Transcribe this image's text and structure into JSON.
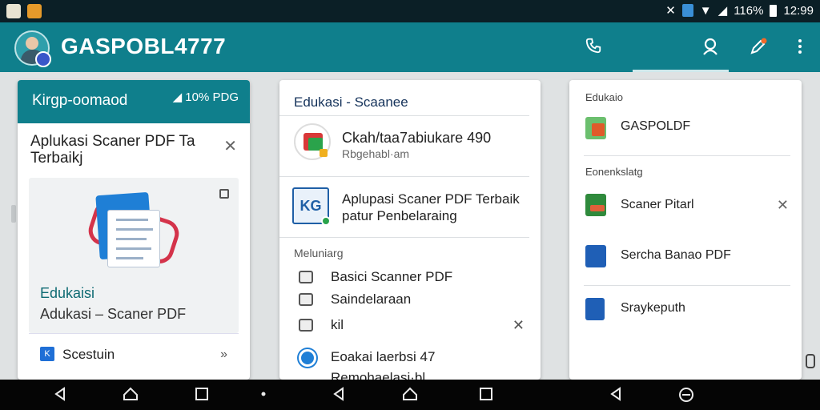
{
  "status_bar": {
    "battery_percent": "116%",
    "time": "12:99",
    "icons": [
      "bluetooth-icon",
      "nfc-icon",
      "wifi-icon",
      "signal-icon",
      "battery-icon"
    ]
  },
  "app_bar": {
    "title": "GASPOBL4777",
    "actions": [
      "phone-icon",
      "search-icon",
      "edit-icon",
      "more-vert-icon"
    ]
  },
  "card1": {
    "header_title": "Kirgp-oomaod",
    "header_status": "10% PDG",
    "dialog_title": "Aplukasi Scaner PDF Ta Terbaikj",
    "edukasi_label": "Edukaisi",
    "subtitle": "Adukasi – Scaner PDF",
    "footer_label": "Scestuin"
  },
  "card2": {
    "title": "Edukasi - Scaanee",
    "app1_name": "Ckah/taa7abiukare 490",
    "app1_sub": "Rbgehabl·am",
    "app2_name": "Aplupasi Scaner PDF Terbaik patur Penbelaraing",
    "section": "Meluniarg",
    "items": [
      "Basici Scanner PDF",
      "Saindelaraan",
      "kil",
      "Eoakai laerbsi 47",
      "Remohaelasi·bl"
    ]
  },
  "card3": {
    "label1": "Edukaio",
    "item1": "GASPOLDF",
    "label2": "Eonenkslatg",
    "item2": "Scaner Pitarl",
    "item3": "Sercha Banao PDF",
    "item4": "Sraykeputh"
  },
  "nav_bar": {
    "buttons": [
      "back-icon",
      "home-icon",
      "recents-icon",
      "dot-icon",
      "back-icon",
      "home-icon",
      "recents-icon",
      "back-icon",
      "assistant-icon"
    ]
  },
  "colors": {
    "teal": "#0f7f8c",
    "status_bar": "#0b1f26",
    "nav_bar": "#050505"
  }
}
